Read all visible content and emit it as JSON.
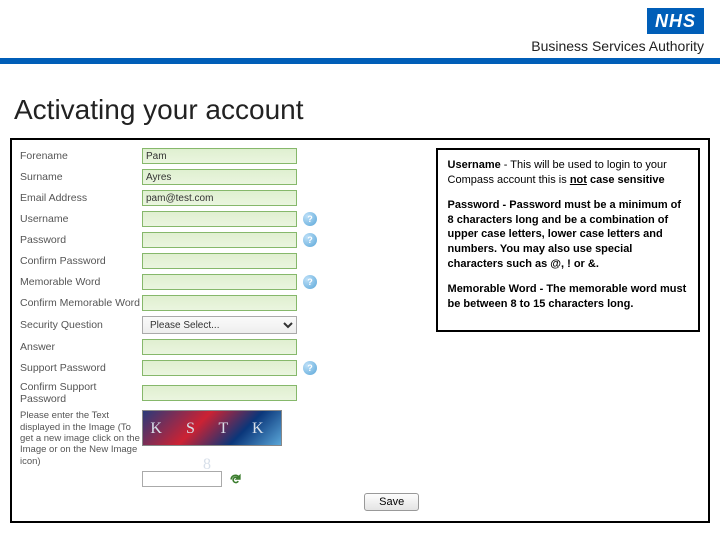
{
  "header": {
    "nhs": "NHS",
    "bsa_line1": "Business Services Authority",
    "bsa_line2": ""
  },
  "page": {
    "title": "Activating your account"
  },
  "form": {
    "forename_label": "Forename",
    "forename_value": "Pam",
    "surname_label": "Surname",
    "surname_value": "Ayres",
    "email_label": "Email Address",
    "email_value": "pam@test.com",
    "username_label": "Username",
    "username_value": "",
    "password_label": "Password",
    "password_value": "",
    "confirm_password_label": "Confirm Password",
    "confirm_password_value": "",
    "memorable_word_label": "Memorable Word",
    "memorable_word_value": "",
    "confirm_memorable_word_label": "Confirm Memorable Word",
    "confirm_memorable_word_value": "",
    "security_question_label": "Security Question",
    "security_question_selected": "Please Select...",
    "answer_label": "Answer",
    "answer_value": "",
    "support_password_label": "Support Password",
    "support_password_value": "",
    "confirm_support_password_label": "Confirm Support Password",
    "confirm_support_password_value": "",
    "captcha_instructions": "Please enter the Text displayed in the Image (To get a new image click on the Image or on the New Image icon)",
    "captcha_text": "K S T K 8",
    "captcha_input_value": "",
    "save_label": "Save"
  },
  "info": {
    "username_label": "Username",
    "username_text": " - This will be used to login to your Compass account this is ",
    "username_not": "not",
    "username_tail": " case sensitive",
    "password_label": "Password",
    "password_text": " - Password must be a minimum of 8 characters long and be a combination of upper case letters, lower case letters and numbers. You may also use special characters such as @, ! or &.",
    "memorable_label": "Memorable Word",
    "memorable_text": " - The memorable word must be between 8 to 15 characters long."
  }
}
